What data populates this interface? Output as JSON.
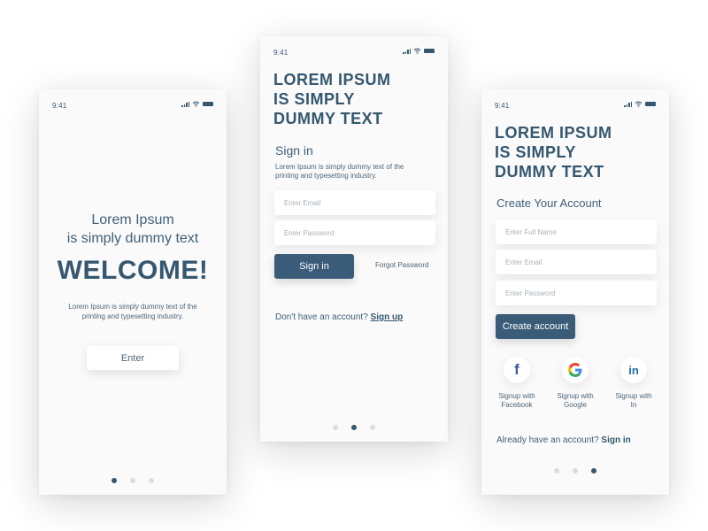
{
  "colors": {
    "primary": "#3a5c78",
    "text": "#35576f",
    "dot_inactive": "#dcdcdc",
    "facebook": "#3b5998",
    "linkedin": "#1e6fa8"
  },
  "status_bar": {
    "time": "9:41"
  },
  "welcome_screen": {
    "subtitle_line1": "Lorem Ipsum",
    "subtitle_line2": "is simply dummy text",
    "title": "WELCOME!",
    "desc_line1": "Lorem Ipsum is simply dummy text of the",
    "desc_line2": "printing and typesetting industry.",
    "enter_label": "Enter",
    "active_page": 1,
    "page_count": 3
  },
  "signin_screen": {
    "headline": [
      "LOREM IPSUM",
      "IS SIMPLY",
      "DUMMY TEXT"
    ],
    "section_title": "Sign in",
    "desc_line1": "Lorem Ipsum is simply dummy text of the",
    "desc_line2": "printing and typesetting industry.",
    "email_placeholder": "Enter Email",
    "password_placeholder": "Enter Password",
    "signin_label": "Sign in",
    "forgot_label": "Forgot Password",
    "no_account_text": "Don't have an account?",
    "signup_link": "Sign up",
    "active_page": 2,
    "page_count": 3
  },
  "signup_screen": {
    "headline": [
      "LOREM IPSUM",
      "IS SIMPLY",
      "DUMMY TEXT"
    ],
    "section_title": "Create Your Account",
    "fullname_placeholder": "Enter Full Name",
    "email_placeholder": "Enter Email",
    "password_placeholder": "Enter Password",
    "create_label": "Create account",
    "social": [
      {
        "icon": "facebook-icon",
        "glyph": "f",
        "label_line1": "Signup with",
        "label_line2": "Facebook"
      },
      {
        "icon": "google-icon",
        "glyph": "G",
        "label_line1": "Signup with",
        "label_line2": "Google"
      },
      {
        "icon": "linkedin-icon",
        "glyph": "in",
        "label_line1": "Signup with",
        "label_line2": "In"
      }
    ],
    "have_account_text": "Already have an account?",
    "signin_link": "Sign in",
    "active_page": 3,
    "page_count": 3
  }
}
